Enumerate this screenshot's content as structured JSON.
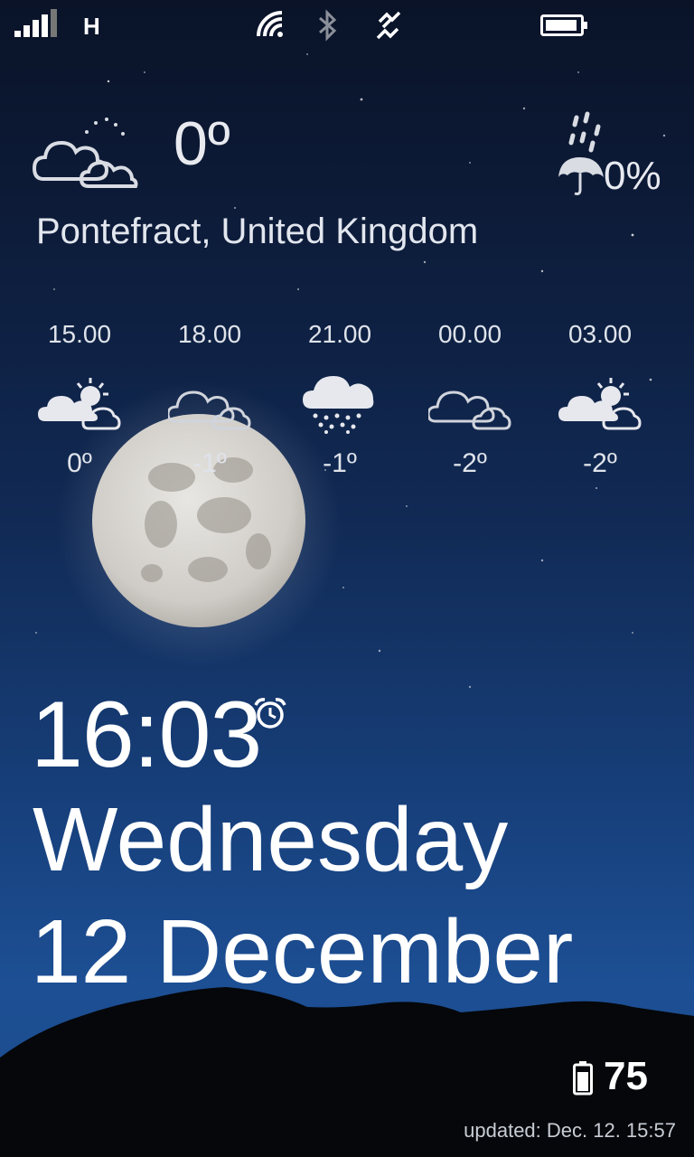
{
  "status_bar": {
    "network": "H",
    "icons": [
      "signal-bars-icon",
      "wifi-icon",
      "bluetooth-icon",
      "sync-icon",
      "battery-icon"
    ]
  },
  "current": {
    "temperature": "0º",
    "icon": "partly-cloudy-night-icon",
    "precip_icon": "umbrella-rain-icon",
    "precip": "0%",
    "location": "Pontefract, United Kingdom"
  },
  "forecast": [
    {
      "time": "15.00",
      "temp": "0º",
      "icon": "partly-cloudy-sun-icon"
    },
    {
      "time": "18.00",
      "temp": "-1º",
      "icon": "cloudy-icon"
    },
    {
      "time": "21.00",
      "temp": "-1º",
      "icon": "snow-cloud-icon"
    },
    {
      "time": "00.00",
      "temp": "-2º",
      "icon": "cloudy-icon"
    },
    {
      "time": "03.00",
      "temp": "-2º",
      "icon": "partly-cloudy-sun-icon"
    }
  ],
  "lock": {
    "time": "16:03",
    "day": "Wednesday",
    "date": "12 December"
  },
  "battery": {
    "percent": "75"
  },
  "updated": "updated: Dec. 12. 15:57",
  "colors": {
    "sky_top": "#0a1328",
    "sky_bottom": "#1d4f94",
    "text": "#ffffff",
    "hills": "#05070b"
  }
}
